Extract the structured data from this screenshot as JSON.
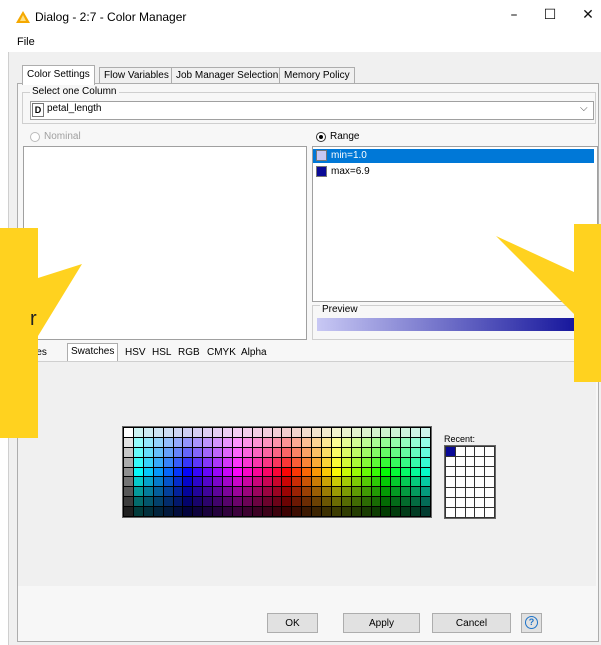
{
  "window": {
    "title": "Dialog - 2:7 - Color Manager",
    "icon": "warning-triangle-icon",
    "minimize_glyph": "–",
    "maximize_glyph": "☐",
    "close_glyph": "✕"
  },
  "menubar": {
    "file": "File"
  },
  "tabs": [
    "Color Settings",
    "Flow Variables",
    "Job Manager Selection",
    "Memory Policy"
  ],
  "column_selector": {
    "group_label": "Select one Column",
    "type_badge": "D",
    "value": "petal_length",
    "arrow": "⌵"
  },
  "nominal": {
    "label": "Nominal"
  },
  "range": {
    "label": "Range",
    "rows": [
      {
        "text": "min=1.0",
        "color": "#c8c8f4",
        "selected": true
      },
      {
        "text": "max=6.9",
        "color": "#0a0a96",
        "selected": false
      }
    ],
    "preview_label": "Preview",
    "gradient_start": "#c8c8f4",
    "gradient_end": "#0a0a96"
  },
  "color_tabs": [
    "lettes",
    "Swatches",
    "HSV",
    "HSL",
    "RGB",
    "CMYK",
    "Alpha"
  ],
  "recent": {
    "label": "Recent:",
    "first_color": "#0a0a96"
  },
  "buttons": {
    "ok": "OK",
    "apply": "Apply",
    "cancel": "Cancel",
    "help": "?"
  },
  "overlay": {
    "left_text_fragment": "r",
    "color": "#ffd21f"
  }
}
